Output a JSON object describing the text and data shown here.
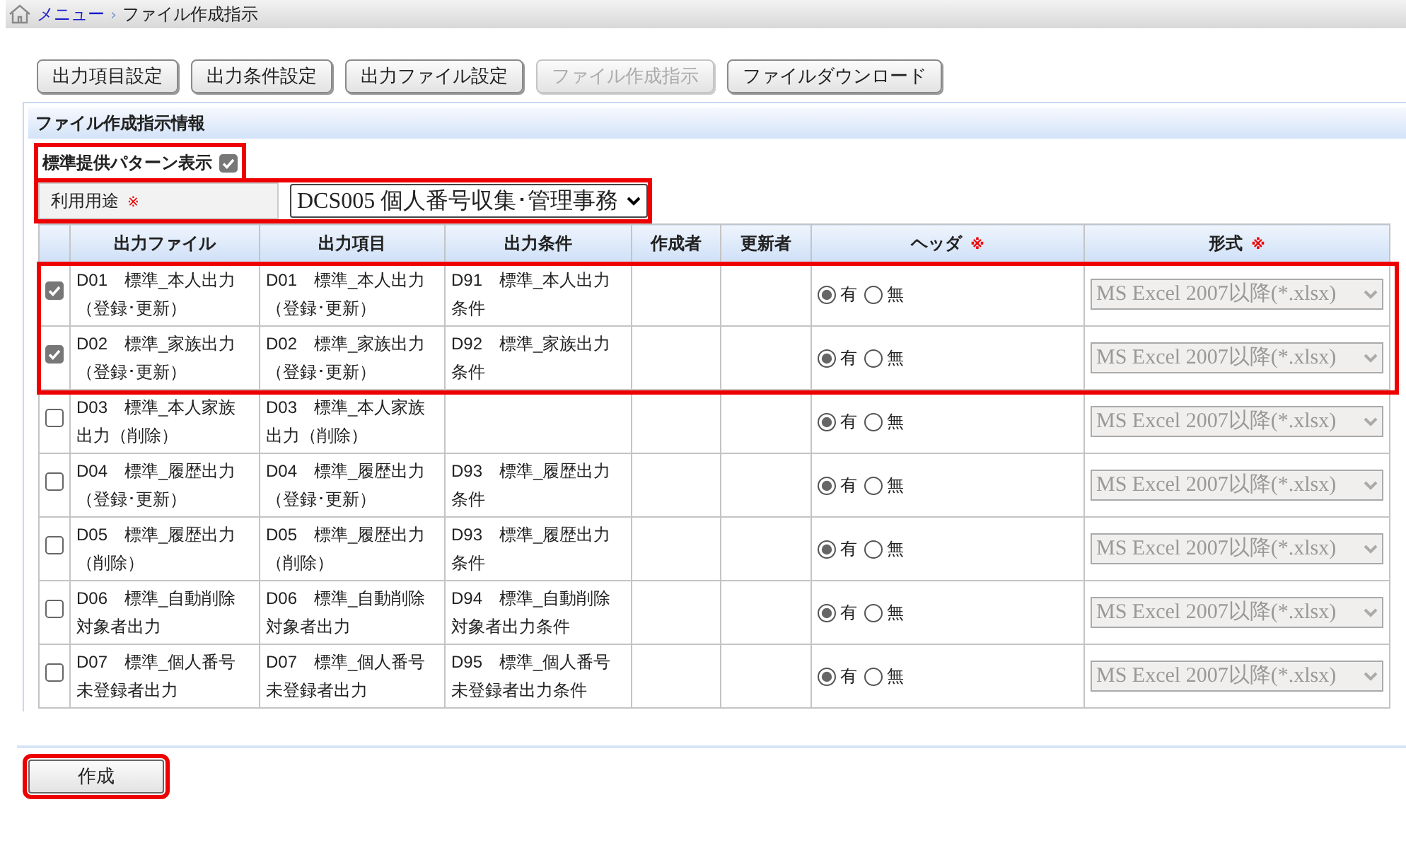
{
  "breadcrumb": {
    "home_link": "メニュー",
    "separator": "›",
    "current": "ファイル作成指示"
  },
  "toolbar": [
    {
      "label": "出力項目設定",
      "disabled": false
    },
    {
      "label": "出力条件設定",
      "disabled": false
    },
    {
      "label": "出力ファイル設定",
      "disabled": false
    },
    {
      "label": "ファイル作成指示",
      "disabled": true
    },
    {
      "label": "ファイルダウンロード",
      "disabled": false
    }
  ],
  "panel": {
    "title": "ファイル作成指示情報",
    "pattern_toggle": {
      "label": "標準提供パターン表示",
      "checked": true,
      "highlighted": true
    },
    "usage": {
      "label": "利用用途",
      "mark": "※",
      "value": "DCS005 個人番号収集･管理事務",
      "highlighted": true
    },
    "columns": [
      {
        "label": "出力ファイル"
      },
      {
        "label": "出力項目"
      },
      {
        "label": "出力条件"
      },
      {
        "label": "作成者"
      },
      {
        "label": "更新者"
      },
      {
        "label": "ヘッダ",
        "mark": "※"
      },
      {
        "label": "形式",
        "mark": "※"
      }
    ],
    "rows": [
      {
        "checked": true,
        "highlighted": true,
        "file": "D01　標準_本人出力（登録･更新）",
        "item": "D01　標準_本人出力（登録･更新）",
        "condition": "D91　標準_本人出力条件",
        "header": [
          {
            "label": "有",
            "selected": true
          },
          {
            "label": "無",
            "selected": false
          }
        ],
        "format": "MS Excel 2007以降(*.xlsx)",
        "format_disabled": true
      },
      {
        "checked": true,
        "highlighted": true,
        "file": "D02　標準_家族出力（登録･更新）",
        "item": "D02　標準_家族出力（登録･更新）",
        "condition": "D92　標準_家族出力条件",
        "header": [
          {
            "label": "有",
            "selected": true
          },
          {
            "label": "無",
            "selected": false
          }
        ],
        "format": "MS Excel 2007以降(*.xlsx)",
        "format_disabled": true
      },
      {
        "checked": false,
        "highlighted": false,
        "file": "D03　標準_本人家族出力（削除）",
        "item": "D03　標準_本人家族出力（削除）",
        "header": [
          {
            "label": "有",
            "selected": true
          },
          {
            "label": "無",
            "selected": false
          }
        ],
        "format": "MS Excel 2007以降(*.xlsx)",
        "format_disabled": true
      },
      {
        "checked": false,
        "highlighted": false,
        "file": "D04　標準_履歴出力（登録･更新）",
        "item": "D04　標準_履歴出力（登録･更新）",
        "condition": "D93　標準_履歴出力条件",
        "header": [
          {
            "label": "有",
            "selected": true
          },
          {
            "label": "無",
            "selected": false
          }
        ],
        "format": "MS Excel 2007以降(*.xlsx)",
        "format_disabled": true
      },
      {
        "checked": false,
        "highlighted": false,
        "file": "D05　標準_履歴出力（削除）",
        "item": "D05　標準_履歴出力（削除）",
        "condition": "D93　標準_履歴出力条件",
        "header": [
          {
            "label": "有",
            "selected": true
          },
          {
            "label": "無",
            "selected": false
          }
        ],
        "format": "MS Excel 2007以降(*.xlsx)",
        "format_disabled": true
      },
      {
        "checked": false,
        "highlighted": false,
        "file": "D06　標準_自動削除対象者出力",
        "item": "D06　標準_自動削除対象者出力",
        "condition": "D94　標準_自動削除対象者出力条件",
        "header": [
          {
            "label": "有",
            "selected": true
          },
          {
            "label": "無",
            "selected": false
          }
        ],
        "format": "MS Excel 2007以降(*.xlsx)",
        "format_disabled": true
      },
      {
        "checked": false,
        "highlighted": false,
        "file": "D07　標準_個人番号未登録者出力",
        "item": "D07　標準_個人番号未登録者出力",
        "condition": "D95　標準_個人番号未登録者出力条件",
        "header": [
          {
            "label": "有",
            "selected": true
          },
          {
            "label": "無",
            "selected": false
          }
        ],
        "format": "MS Excel 2007以降(*.xlsx)",
        "format_disabled": true
      }
    ]
  },
  "create_button": {
    "label": "作成",
    "highlighted": true
  }
}
